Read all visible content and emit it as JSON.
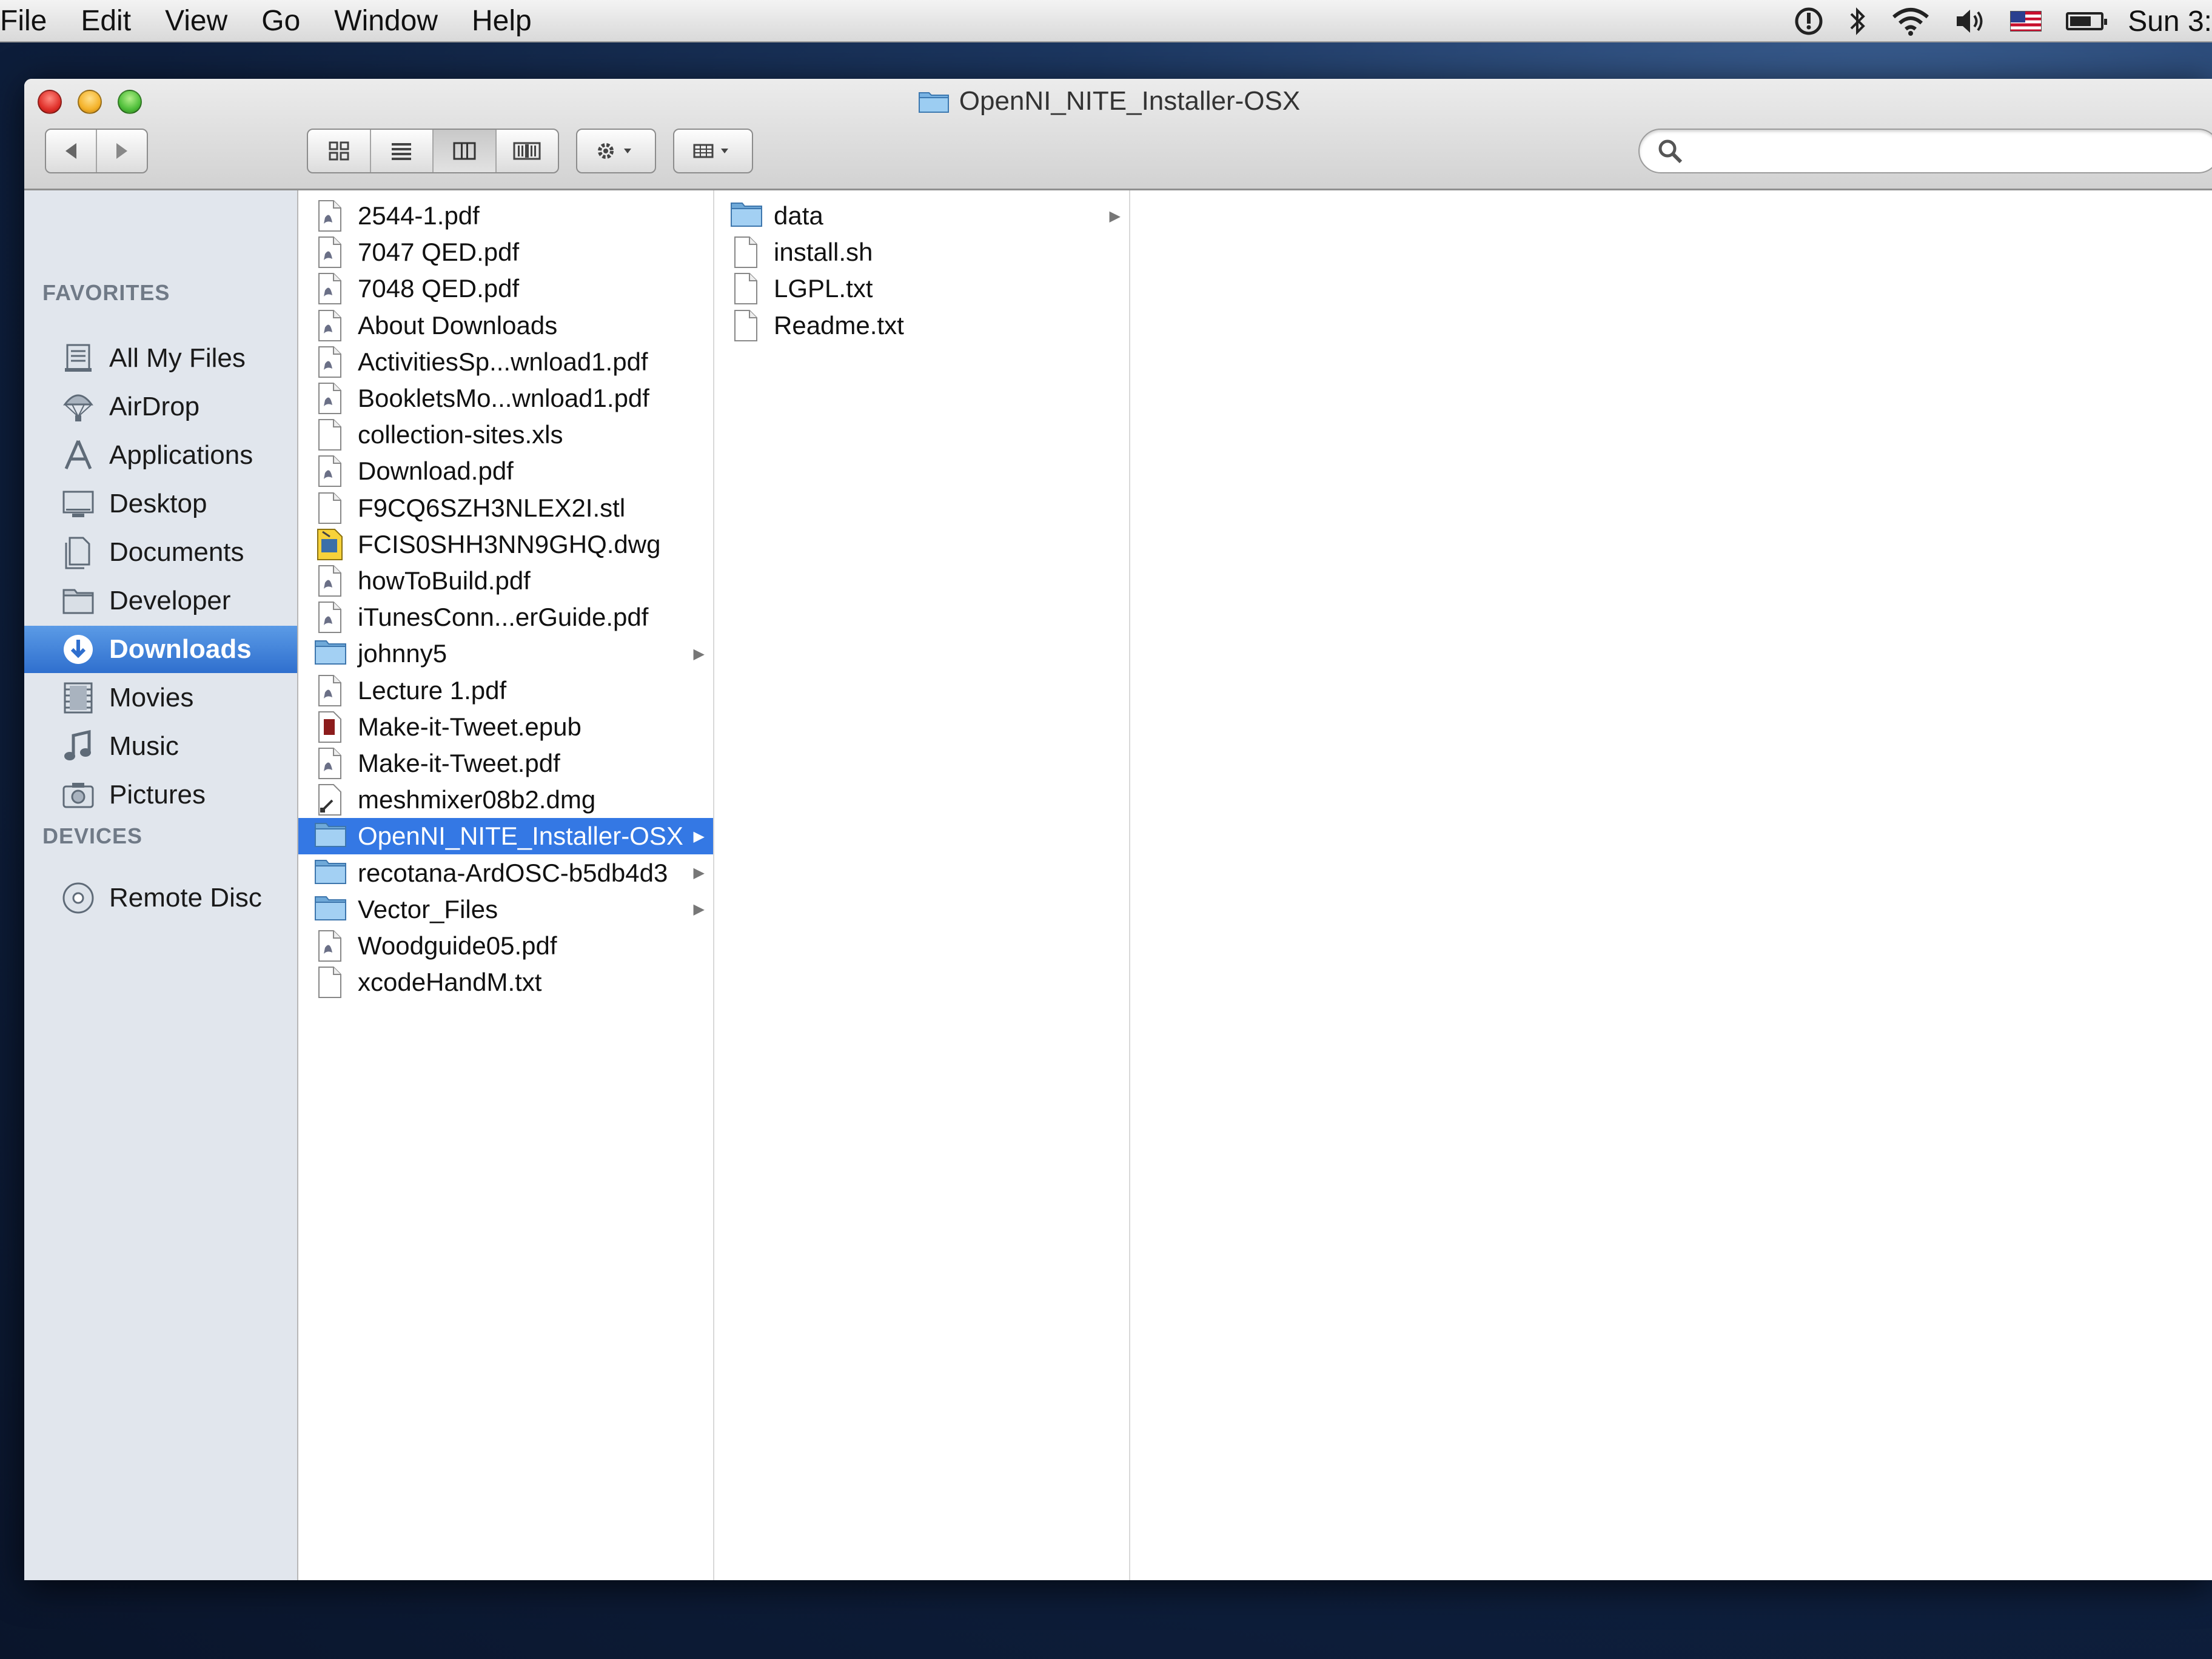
{
  "menubar": {
    "items": [
      "File",
      "Edit",
      "View",
      "Go",
      "Window",
      "Help"
    ],
    "clock": "Sun 3:"
  },
  "window": {
    "title": "OpenNI_NITE_Installer-OSX",
    "search": {
      "placeholder": "",
      "value": ""
    }
  },
  "sidebar": {
    "favorites_header": "FAVORITES",
    "devices_header": "DEVICES",
    "favorites": [
      {
        "label": "All My Files",
        "icon": "all-files-icon"
      },
      {
        "label": "AirDrop",
        "icon": "airdrop-icon"
      },
      {
        "label": "Applications",
        "icon": "applications-icon"
      },
      {
        "label": "Desktop",
        "icon": "desktop-icon"
      },
      {
        "label": "Documents",
        "icon": "documents-icon"
      },
      {
        "label": "Developer",
        "icon": "folder-icon"
      },
      {
        "label": "Downloads",
        "icon": "downloads-icon",
        "selected": true
      },
      {
        "label": "Movies",
        "icon": "movies-icon"
      },
      {
        "label": "Music",
        "icon": "music-icon"
      },
      {
        "label": "Pictures",
        "icon": "pictures-icon"
      }
    ],
    "devices": [
      {
        "label": "Remote Disc",
        "icon": "disc-icon"
      }
    ]
  },
  "column1": [
    {
      "name": "2544-1.pdf",
      "kind": "pdf"
    },
    {
      "name": "7047 QED.pdf",
      "kind": "pdf"
    },
    {
      "name": "7048 QED.pdf",
      "kind": "pdf"
    },
    {
      "name": "About Downloads",
      "kind": "pdf"
    },
    {
      "name": "ActivitiesSp...wnload1.pdf",
      "kind": "pdf"
    },
    {
      "name": "BookletsMo...wnload1.pdf",
      "kind": "pdf"
    },
    {
      "name": "collection-sites.xls",
      "kind": "doc"
    },
    {
      "name": "Download.pdf",
      "kind": "pdf"
    },
    {
      "name": "F9CQ6SZH3NLEX2I.stl",
      "kind": "doc"
    },
    {
      "name": "FCIS0SHH3NN9GHQ.dwg",
      "kind": "dwg"
    },
    {
      "name": "howToBuild.pdf",
      "kind": "pdf"
    },
    {
      "name": "iTunesConn...erGuide.pdf",
      "kind": "pdf"
    },
    {
      "name": "johnny5",
      "kind": "folder"
    },
    {
      "name": "Lecture 1.pdf",
      "kind": "pdf"
    },
    {
      "name": "Make-it-Tweet.epub",
      "kind": "epub"
    },
    {
      "name": "Make-it-Tweet.pdf",
      "kind": "pdf"
    },
    {
      "name": "meshmixer08b2.dmg",
      "kind": "dmg"
    },
    {
      "name": "OpenNI_NITE_Installer-OSX",
      "kind": "folder",
      "selected": true
    },
    {
      "name": "recotana-ArdOSC-b5db4d3",
      "kind": "folder"
    },
    {
      "name": "Vector_Files",
      "kind": "folder"
    },
    {
      "name": "Woodguide05.pdf",
      "kind": "pdf"
    },
    {
      "name": "xcodeHandM.txt",
      "kind": "doc"
    }
  ],
  "column2": [
    {
      "name": "data",
      "kind": "folder"
    },
    {
      "name": "install.sh",
      "kind": "doc"
    },
    {
      "name": "LGPL.txt",
      "kind": "doc"
    },
    {
      "name": "Readme.txt",
      "kind": "doc"
    }
  ],
  "colors": {
    "selection": "#3478e4",
    "sidebar_selection": "#2f6fce",
    "sidebar_bg": "#e1e6ed",
    "folder": "#8cc3ec"
  }
}
